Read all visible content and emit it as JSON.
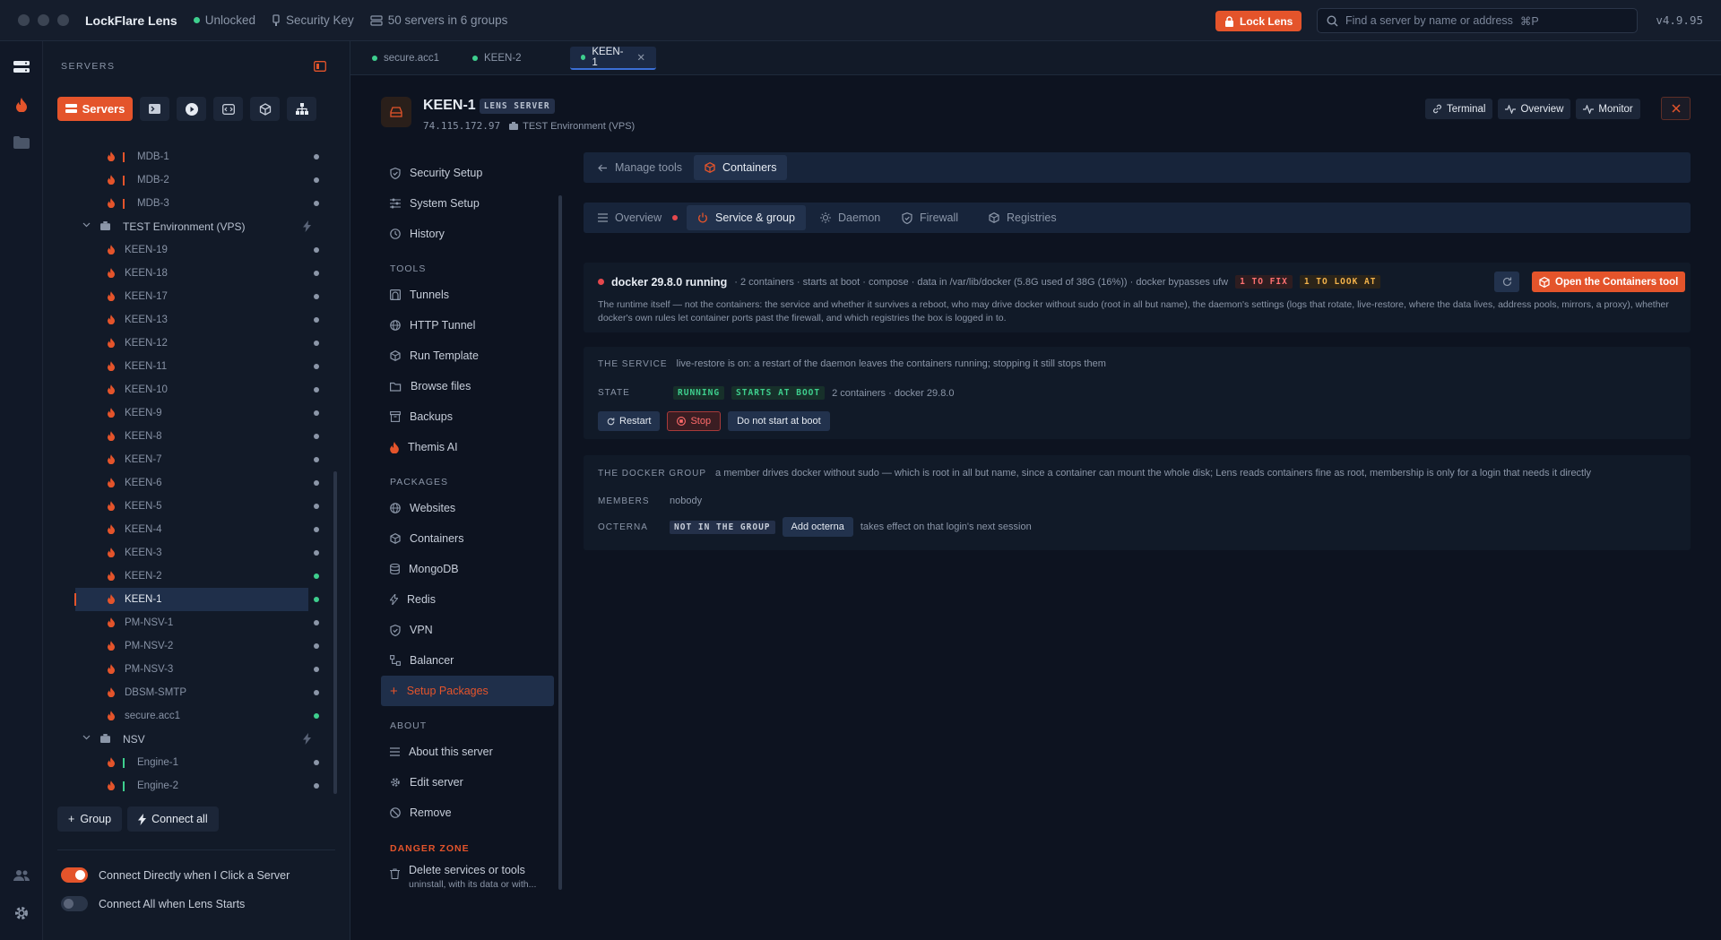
{
  "titlebar": {
    "app_name": "LockFlare Lens",
    "lock_status": "Unlocked",
    "security_key": "Security Key",
    "servers_summary": "50 servers in 6 groups",
    "lock_button": "Lock Lens",
    "search_placeholder": "Find a server by name or address",
    "search_shortcut": "⌘P",
    "version": "v4.9.95"
  },
  "sidebar": {
    "heading": "SERVERS",
    "toolbar": {
      "servers_label": "Servers"
    },
    "nodes_top": [
      {
        "label": "MDB-1"
      },
      {
        "label": "MDB-2"
      },
      {
        "label": "MDB-3"
      }
    ],
    "group_test": "TEST Environment (VPS)",
    "nodes_test": [
      {
        "label": "KEEN-19",
        "status": "gray"
      },
      {
        "label": "KEEN-18",
        "status": "gray"
      },
      {
        "label": "KEEN-17",
        "status": "gray"
      },
      {
        "label": "KEEN-13",
        "status": "gray"
      },
      {
        "label": "KEEN-12",
        "status": "gray"
      },
      {
        "label": "KEEN-11",
        "status": "gray"
      },
      {
        "label": "KEEN-10",
        "status": "gray"
      },
      {
        "label": "KEEN-9",
        "status": "gray"
      },
      {
        "label": "KEEN-8",
        "status": "gray"
      },
      {
        "label": "KEEN-7",
        "status": "gray"
      },
      {
        "label": "KEEN-6",
        "status": "gray"
      },
      {
        "label": "KEEN-5",
        "status": "gray"
      },
      {
        "label": "KEEN-4",
        "status": "gray"
      },
      {
        "label": "KEEN-3",
        "status": "gray"
      },
      {
        "label": "KEEN-2",
        "status": "green"
      },
      {
        "label": "KEEN-1",
        "status": "green"
      },
      {
        "label": "PM-NSV-1",
        "status": "gray"
      },
      {
        "label": "PM-NSV-2",
        "status": "gray"
      },
      {
        "label": "PM-NSV-3",
        "status": "gray"
      },
      {
        "label": "DBSM-SMTP",
        "status": "gray"
      },
      {
        "label": "secure.acc1",
        "status": "green"
      }
    ],
    "group_nsv": "NSV",
    "nodes_nsv": [
      {
        "label": "Engine-1"
      },
      {
        "label": "Engine-2"
      }
    ],
    "group_button": "Group",
    "connect_all_button": "Connect all",
    "toggle_connect_direct": "Connect Directly when I Click a Server",
    "toggle_connect_all": "Connect All when Lens Starts"
  },
  "tabs": [
    {
      "label": "secure.acc1"
    },
    {
      "label": "KEEN-2"
    },
    {
      "label": "KEEN-1"
    }
  ],
  "server": {
    "name": "KEEN-1",
    "badge": "LENS SERVER",
    "address": "74.115.172.97",
    "group": "TEST Environment (VPS)",
    "buttons": {
      "terminal": "Terminal",
      "overview": "Overview",
      "monitor": "Monitor"
    }
  },
  "subnav": {
    "items_top": [
      "Security Setup",
      "System Setup",
      "History"
    ],
    "tools_heading": "TOOLS",
    "tools": [
      "Tunnels",
      "HTTP Tunnel",
      "Run Template",
      "Browse files",
      "Backups",
      "Themis AI"
    ],
    "packages_heading": "PACKAGES",
    "packages": [
      "Websites",
      "Containers",
      "MongoDB",
      "Redis",
      "VPN",
      "Balancer",
      "Setup Packages"
    ],
    "about_heading": "ABOUT",
    "about": [
      "About this server",
      "Edit server",
      "Remove"
    ],
    "danger_heading": "DANGER ZONE",
    "danger_item": "Delete services or tools",
    "danger_sub": "uninstall, with its data or with..."
  },
  "main": {
    "breadcrumb_back": "Manage tools",
    "breadcrumb_current": "Containers",
    "subtabs": [
      "Overview",
      "Service & group",
      "Daemon",
      "Firewall",
      "Registries"
    ],
    "status_title": "docker 29.8.0 running",
    "status_meta": "· 2 containers · starts at boot · compose · data in /var/lib/docker (5.8G used of 38G (16%)) · docker bypasses ufw",
    "chip_fix": "1 TO FIX",
    "chip_look": "1 TO LOOK AT",
    "open_button": "Open the Containers tool",
    "description": "The runtime itself — not the containers: the service and whether it survives a reboot, who may drive docker without sudo (root in all but name), the daemon's settings (logs that rotate, live-restore, where the data lives, address pools, mirrors, a proxy), whether docker's own rules let container ports past the firewall, and which registries the box is logged in to.",
    "service": {
      "label": "THE SERVICE",
      "note": "live-restore is on: a restart of the daemon leaves the containers running; stopping it still stops them",
      "state_label": "STATE",
      "chip_running": "RUNNING",
      "chip_boot": "STARTS AT BOOT",
      "state_meta": "2 containers · docker 29.8.0",
      "restart": "Restart",
      "stop": "Stop",
      "no_boot": "Do not start at boot"
    },
    "group": {
      "label": "THE DOCKER GROUP",
      "note": "a member drives docker without sudo — which is root in all but name, since a container can mount the whole disk; Lens reads containers fine as root, membership is only for a login that needs it directly",
      "members_label": "MEMBERS",
      "members_value": "nobody",
      "octerna_label": "OCTERNA",
      "chip_not_in": "NOT IN THE GROUP",
      "add_button": "Add octerna",
      "octerna_note": "takes effect on that login's next session"
    }
  }
}
